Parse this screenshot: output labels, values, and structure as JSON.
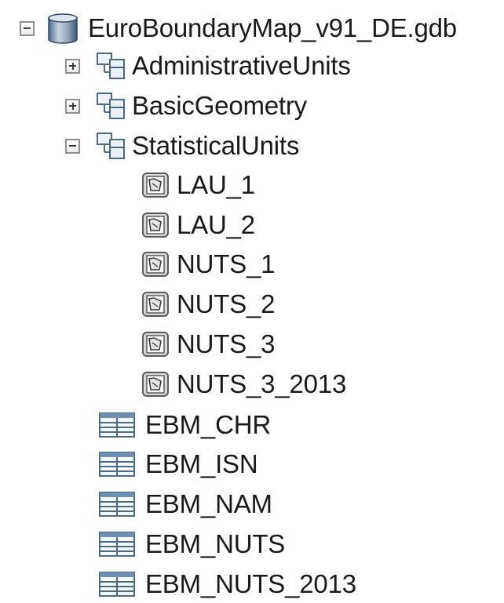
{
  "tree": {
    "root": {
      "label": "EuroBoundaryMap_v91_DE.gdb",
      "icon": "database-icon",
      "expanded": true
    },
    "datasets": [
      {
        "label": "AdministrativeUnits",
        "icon": "feature-dataset-icon",
        "expanded": false
      },
      {
        "label": "BasicGeometry",
        "icon": "feature-dataset-icon",
        "expanded": false
      },
      {
        "label": "StatisticalUnits",
        "icon": "feature-dataset-icon",
        "expanded": true
      }
    ],
    "feature_classes": [
      {
        "label": "LAU_1",
        "icon": "polygon-feature-class-icon"
      },
      {
        "label": "LAU_2",
        "icon": "polygon-feature-class-icon"
      },
      {
        "label": "NUTS_1",
        "icon": "polygon-feature-class-icon"
      },
      {
        "label": "NUTS_2",
        "icon": "polygon-feature-class-icon"
      },
      {
        "label": "NUTS_3",
        "icon": "polygon-feature-class-icon"
      },
      {
        "label": "NUTS_3_2013",
        "icon": "polygon-feature-class-icon"
      }
    ],
    "tables": [
      {
        "label": "EBM_CHR",
        "icon": "table-icon"
      },
      {
        "label": "EBM_ISN",
        "icon": "table-icon"
      },
      {
        "label": "EBM_NAM",
        "icon": "table-icon"
      },
      {
        "label": "EBM_NUTS",
        "icon": "table-icon"
      },
      {
        "label": "EBM_NUTS_2013",
        "icon": "table-icon"
      }
    ]
  }
}
